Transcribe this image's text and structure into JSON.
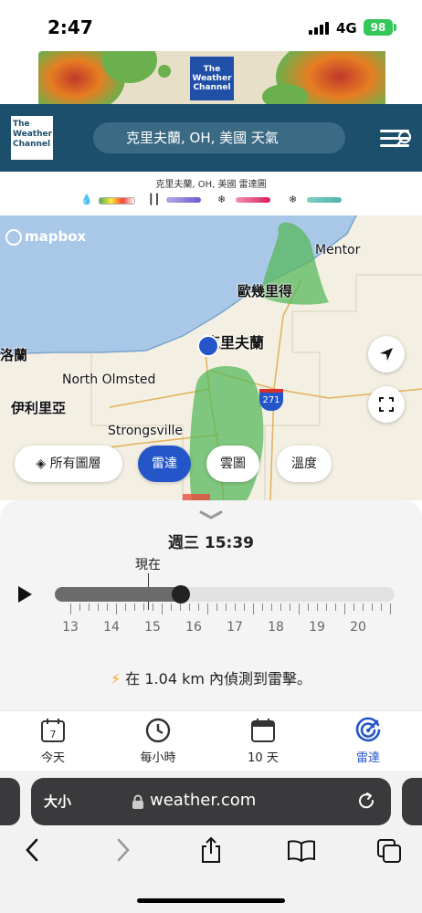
{
  "status_bar": {
    "time": "2:47",
    "network": "4G",
    "battery": "98"
  },
  "ad": {
    "logo_text": "The Weather Channel"
  },
  "header": {
    "logo_text": "The Weather Channel",
    "search_text": "克里夫蘭, OH, 美國 天氣"
  },
  "radar_legend": {
    "title": "克里夫蘭, OH, 美國 雷達圖",
    "items": [
      {
        "icon": "rain-icon",
        "colors": [
          "#4caf50",
          "#ffeb3b",
          "#f44336"
        ]
      },
      {
        "icon": "ice-icon",
        "colors": [
          "#8e7cc3",
          "#6a5acd"
        ]
      },
      {
        "icon": "mix-icon",
        "colors": [
          "#d81b60",
          "#f06292"
        ]
      },
      {
        "icon": "snow-icon",
        "colors": [
          "#4db6ac",
          "#80cbc4"
        ]
      }
    ]
  },
  "map": {
    "attribution": "mapbox",
    "cities": {
      "mentor": "Mentor",
      "euclid": "歐幾里得",
      "cleveland": "克里夫蘭",
      "lorain": "洛蘭",
      "north_olmsted": "North Olmsted",
      "elyria": "伊利里亞",
      "strongsville": "Strongsville"
    },
    "highway": "271",
    "layer_chips": {
      "all_layers": "所有圖層",
      "radar": "雷達",
      "clouds": "雲圖",
      "temperature": "溫度"
    }
  },
  "timeline": {
    "datetime": "週三 15:39",
    "now_label": "現在",
    "progress": 0.37,
    "hours": [
      "13",
      "14",
      "15",
      "16",
      "17",
      "18",
      "19",
      "20"
    ],
    "lightning_alert": "在 1.04 km 內偵測到雷擊。"
  },
  "tabs": [
    {
      "label": "今天",
      "icon": "calendar-day-icon",
      "day": "7"
    },
    {
      "label": "每小時",
      "icon": "clock-icon"
    },
    {
      "label": "10 天",
      "icon": "calendar-icon"
    },
    {
      "label": "雷達",
      "icon": "radar-icon"
    }
  ],
  "browser": {
    "text_size": "大小",
    "url": "weather.com"
  },
  "colors": {
    "header": "#1b4f6b",
    "accent": "#2456c9",
    "battery": "#34c759"
  }
}
